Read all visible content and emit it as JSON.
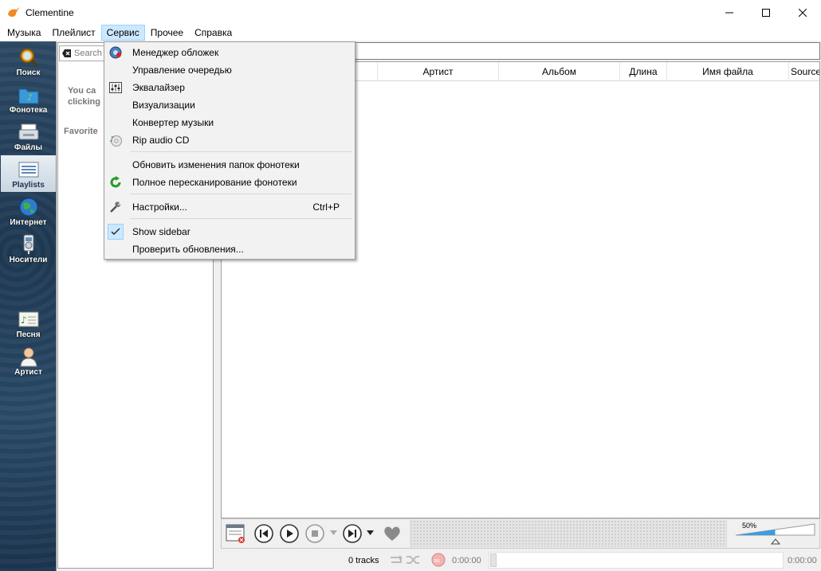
{
  "window": {
    "title": "Clementine"
  },
  "menubar": [
    "Музыка",
    "Плейлист",
    "Сервис",
    "Прочее",
    "Справка"
  ],
  "active_menu": "Сервис",
  "sidebar": {
    "tabs": [
      {
        "label": "Поиск",
        "icon": "search-icon"
      },
      {
        "label": "Фонотека",
        "icon": "library-icon"
      },
      {
        "label": "Файлы",
        "icon": "files-icon"
      },
      {
        "label": "Playlists",
        "icon": "playlists-icon",
        "selected": true
      },
      {
        "label": "Интернет",
        "icon": "internet-icon"
      },
      {
        "label": "Носители",
        "icon": "devices-icon"
      },
      {
        "label": "Песня",
        "icon": "song-icon"
      },
      {
        "label": "Артист",
        "icon": "artist-icon"
      }
    ]
  },
  "left_panel": {
    "search_placeholder": "Search",
    "hint_line1": "You ca",
    "hint_line2": "clicking",
    "favorites": "Favorite"
  },
  "playlist": {
    "columns": [
      "Артист",
      "Альбом",
      "Длина",
      "Имя файла",
      "Source"
    ]
  },
  "service_menu": {
    "items": [
      {
        "label": "Менеджер обложек",
        "icon": "cover-manager-icon"
      },
      {
        "label": "Управление очередью",
        "icon": ""
      },
      {
        "label": "Эквалайзер",
        "icon": "equalizer-icon"
      },
      {
        "label": "Визуализации",
        "icon": ""
      },
      {
        "label": "Конвертер музыки",
        "icon": ""
      },
      {
        "label": "Rip audio CD",
        "icon": "cd-icon"
      },
      {
        "label": "Обновить изменения папок фонотеки",
        "icon": ""
      },
      {
        "label": "Полное пересканирование фонотеки",
        "icon": "refresh-icon"
      },
      {
        "label": "Настройки...",
        "icon": "settings-icon",
        "shortcut": "Ctrl+P"
      },
      {
        "label": "Show sidebar",
        "icon": "check-icon",
        "checked": true
      },
      {
        "label": "Проверить обновления...",
        "icon": ""
      }
    ]
  },
  "player": {
    "volume_label": "50%",
    "volume": 0.5
  },
  "status": {
    "tracks": "0 tracks",
    "time_elapsed": "0:00:00",
    "time_total": "0:00:00"
  }
}
